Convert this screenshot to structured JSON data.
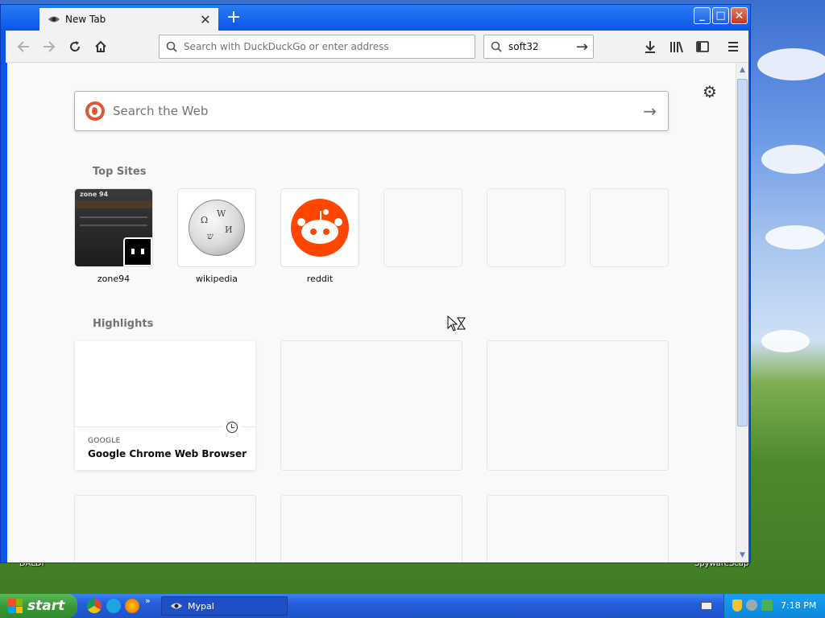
{
  "tab": {
    "title": "New Tab",
    "close_icon": "close-icon",
    "favicon": "mypal-icon"
  },
  "new_tab_symbol": "+",
  "window_buttons": {
    "minimize": "_",
    "maximize": "□",
    "close": "✕"
  },
  "navbar": {
    "url_placeholder": "Search with DuckDuckGo or enter address",
    "search_value": "soft32"
  },
  "newtab_page": {
    "web_search_placeholder": "Search the Web",
    "top_sites_title": "Top Sites",
    "top_sites": [
      {
        "label": "zone94"
      },
      {
        "label": "wikipedia"
      },
      {
        "label": "reddit"
      },
      {
        "label": ""
      },
      {
        "label": ""
      },
      {
        "label": ""
      }
    ],
    "highlights_title": "Highlights",
    "highlights": [
      {
        "source": "GOOGLE",
        "title": "Google Chrome Web Browser"
      }
    ]
  },
  "desktop": {
    "left_label": "DALDI",
    "right_label": "SpywareScap"
  },
  "taskbar": {
    "start_label": "start",
    "task_label": "Mypal",
    "time": "7:18 PM",
    "overflow": "»"
  },
  "colors": {
    "accent": "#0a84ff",
    "reddit": "#ff4500",
    "ddg": "#de5833",
    "xp_blue": "#245edb",
    "xp_start": "#3a9a37"
  }
}
